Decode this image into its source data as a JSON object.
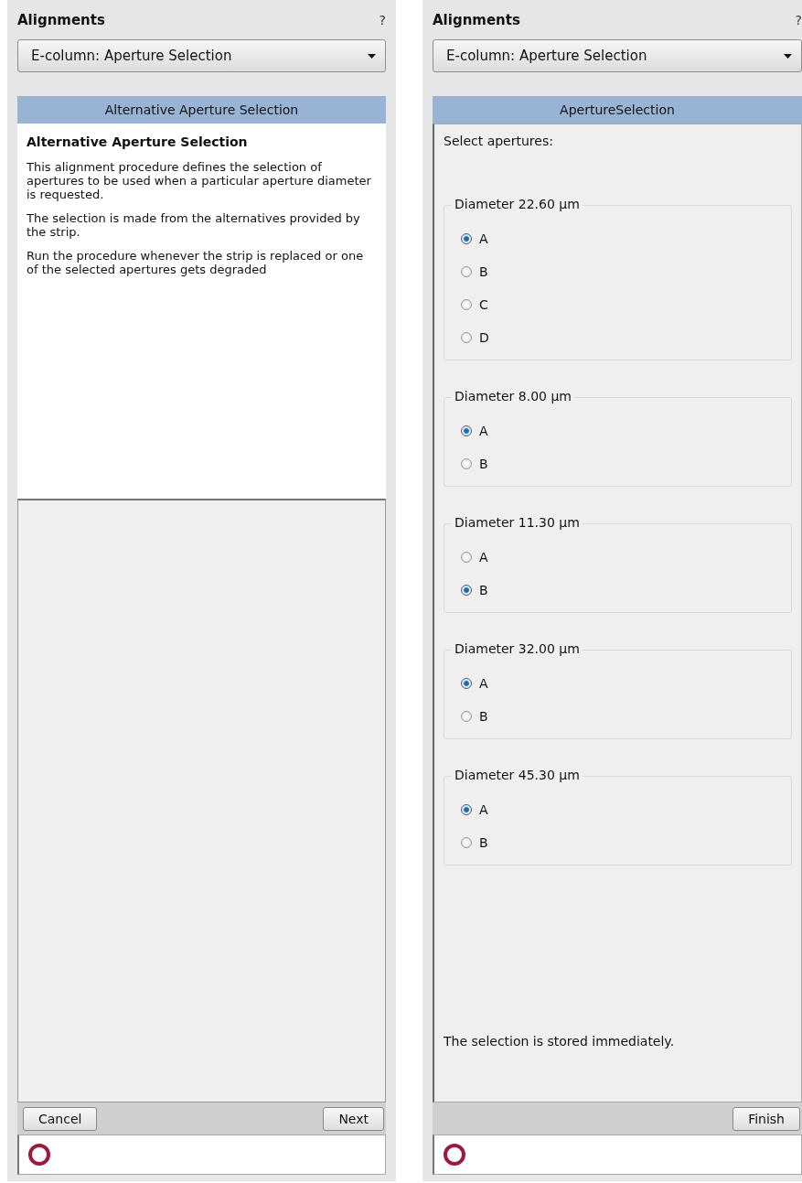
{
  "panels": [
    {
      "title": "Alignments",
      "help": "?",
      "dropdown": {
        "value": "E-column: Aperture Selection"
      },
      "header": "Alternative Aperture Selection",
      "content": {
        "kind": "description",
        "heading": "Alternative Aperture Selection",
        "paragraphs": [
          "This alignment procedure defines the selection of apertures to be used when a particular aperture diameter is requested.",
          "The selection is made from the alternatives provided by the strip.",
          "Run the procedure whenever the strip is replaced or one of the selected apertures gets degraded"
        ]
      },
      "buttons_left": [
        {
          "label": "Cancel"
        }
      ],
      "buttons_right": [
        {
          "label": "Next"
        }
      ]
    },
    {
      "title": "Alignments",
      "help": "?",
      "dropdown": {
        "value": "E-column: Aperture Selection"
      },
      "header": "ApertureSelection",
      "content": {
        "kind": "selection",
        "intro": "Select apertures:",
        "groups": [
          {
            "label": "Diameter 22.60 µm",
            "options": [
              {
                "label": "A",
                "selected": true
              },
              {
                "label": "B",
                "selected": false
              },
              {
                "label": "C",
                "selected": false
              },
              {
                "label": "D",
                "selected": false
              }
            ]
          },
          {
            "label": "Diameter 8.00 µm",
            "options": [
              {
                "label": "A",
                "selected": true
              },
              {
                "label": "B",
                "selected": false
              }
            ]
          },
          {
            "label": "Diameter 11.30 µm",
            "options": [
              {
                "label": "A",
                "selected": false
              },
              {
                "label": "B",
                "selected": true
              }
            ]
          },
          {
            "label": "Diameter 32.00 µm",
            "options": [
              {
                "label": "A",
                "selected": true
              },
              {
                "label": "B",
                "selected": false
              }
            ]
          },
          {
            "label": "Diameter 45.30 µm",
            "options": [
              {
                "label": "A",
                "selected": true
              },
              {
                "label": "B",
                "selected": false
              }
            ]
          }
        ],
        "footer": "The selection is stored immediately."
      },
      "buttons_right": [
        {
          "label": "Finish"
        }
      ]
    }
  ]
}
